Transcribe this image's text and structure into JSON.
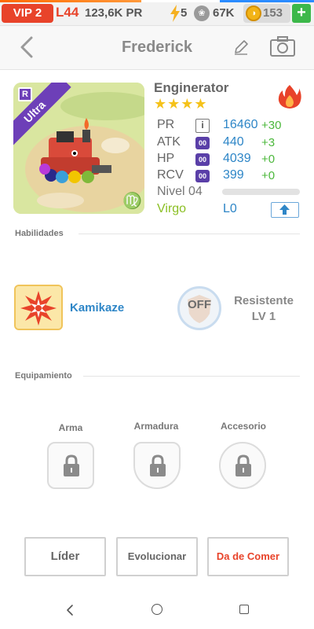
{
  "status": {
    "vip": "VIP 2",
    "level": "L44",
    "pr_total": "123,6K PR",
    "energy": "5",
    "paws": "67K",
    "coins": "153",
    "add": "+"
  },
  "header": {
    "title": "Frederick"
  },
  "pet": {
    "species": "Enginerator",
    "rarity_badge": "R",
    "rarity": "Ultra",
    "stars": "★★★★",
    "stats": [
      {
        "label": "PR",
        "value": "16460",
        "bonus": "+30"
      },
      {
        "label": "ATK",
        "value": "440",
        "bonus": "+3"
      },
      {
        "label": "HP",
        "value": "4039",
        "bonus": "+0"
      },
      {
        "label": "RCV",
        "value": "399",
        "bonus": "+0"
      }
    ],
    "stat_icon_info": "i",
    "stat_icon_badge": "00",
    "level": "Nivel 04",
    "xp_fraction": 0.0,
    "zodiac": "Virgo",
    "zodiac_symbol": "♍",
    "limit": "L0"
  },
  "skills": {
    "section": "Habilidades",
    "active": "Kamikaze",
    "passive_state": "OFF",
    "passive_name": "Resistente",
    "passive_level": "LV 1"
  },
  "equipment": {
    "section": "Equipamiento",
    "slots": [
      "Arma",
      "Armadura",
      "Accesorio"
    ]
  },
  "actions": {
    "leader": "Líder",
    "evolve": "Evolucionar",
    "feed": "Da de Comer"
  },
  "colors": {
    "accent_red": "#e8432a",
    "link_blue": "#2e86c7",
    "bonus_green": "#4cb83c",
    "zodiac_green": "#8bbf24",
    "ultra_purple": "#6d3fb8"
  }
}
